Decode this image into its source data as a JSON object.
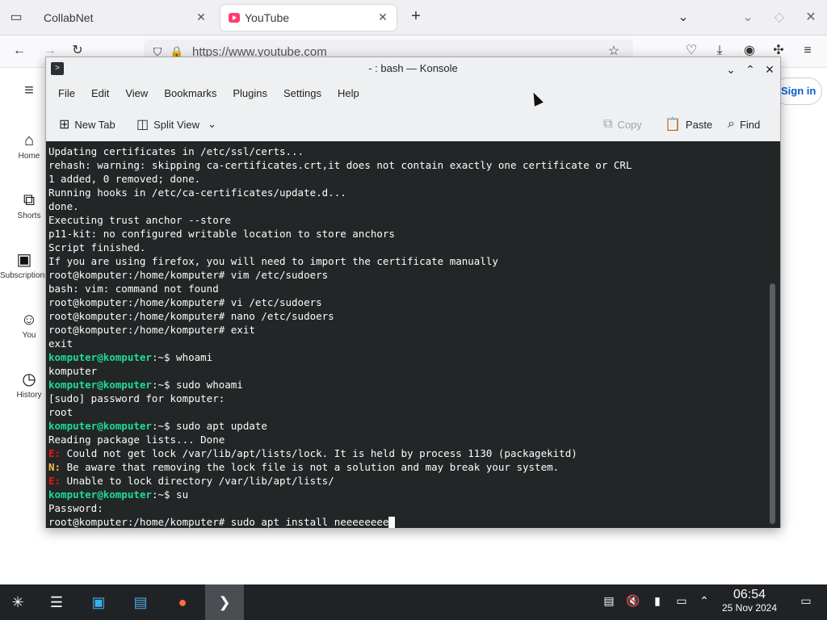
{
  "browser": {
    "tabs": [
      {
        "label": "CollabNet"
      },
      {
        "label": "YouTube"
      }
    ],
    "new_tab_glyph": "+",
    "url": "https://www.youtube.com"
  },
  "youtube": {
    "sidebar": [
      {
        "label": "Home",
        "icon": "home-icon"
      },
      {
        "label": "Shorts",
        "icon": "shorts-icon"
      },
      {
        "label": "Subscriptions",
        "icon": "subscriptions-icon"
      },
      {
        "label": "You",
        "icon": "you-icon"
      },
      {
        "label": "History",
        "icon": "history-icon"
      }
    ],
    "sign_in": "Sign in"
  },
  "konsole": {
    "title": "- : bash — Konsole",
    "menu": [
      "File",
      "Edit",
      "View",
      "Bookmarks",
      "Plugins",
      "Settings",
      "Help"
    ],
    "toolbar": {
      "new_tab": "New Tab",
      "split_view": "Split View",
      "copy": "Copy",
      "paste": "Paste",
      "find": "Find"
    },
    "lines": [
      {
        "type": "plain",
        "text": "Updating certificates in /etc/ssl/certs..."
      },
      {
        "type": "plain",
        "text": "rehash: warning: skipping ca-certificates.crt,it does not contain exactly one certificate or CRL"
      },
      {
        "type": "plain",
        "text": "1 added, 0 removed; done."
      },
      {
        "type": "plain",
        "text": "Running hooks in /etc/ca-certificates/update.d..."
      },
      {
        "type": "plain",
        "text": "done."
      },
      {
        "type": "plain",
        "text": "Executing trust anchor --store"
      },
      {
        "type": "plain",
        "text": "p11-kit: no configured writable location to store anchors"
      },
      {
        "type": "plain",
        "text": "Script finished."
      },
      {
        "type": "plain",
        "text": "If you are using firefox, you will need to import the certificate manually"
      },
      {
        "type": "plain",
        "text": "root@komputer:/home/komputer# vim /etc/sudoers"
      },
      {
        "type": "plain",
        "text": "bash: vim: command not found"
      },
      {
        "type": "plain",
        "text": "root@komputer:/home/komputer# vi /etc/sudoers"
      },
      {
        "type": "plain",
        "text": "root@komputer:/home/komputer# nano /etc/sudoers"
      },
      {
        "type": "plain",
        "text": "root@komputer:/home/komputer# exit"
      },
      {
        "type": "plain",
        "text": "exit"
      },
      {
        "type": "prompt",
        "user": "komputer@komputer",
        "path": ":~$ ",
        "cmd": "whoami"
      },
      {
        "type": "plain",
        "text": "komputer"
      },
      {
        "type": "prompt",
        "user": "komputer@komputer",
        "path": ":~$ ",
        "cmd": "sudo whoami"
      },
      {
        "type": "plain",
        "text": "[sudo] password for komputer:"
      },
      {
        "type": "plain",
        "text": "root"
      },
      {
        "type": "prompt",
        "user": "komputer@komputer",
        "path": ":~$ ",
        "cmd": "sudo apt update"
      },
      {
        "type": "plain",
        "text": "Reading package lists... Done"
      },
      {
        "type": "err",
        "tag": "E:",
        "text": " Could not get lock /var/lib/apt/lists/lock. It is held by process 1130 (packagekitd)"
      },
      {
        "type": "warn",
        "tag": "N:",
        "text": " Be aware that removing the lock file is not a solution and may break your system."
      },
      {
        "type": "err",
        "tag": "E:",
        "text": " Unable to lock directory /var/lib/apt/lists/"
      },
      {
        "type": "prompt",
        "user": "komputer@komputer",
        "path": ":~$ ",
        "cmd": "su"
      },
      {
        "type": "plain",
        "text": "Password:"
      },
      {
        "type": "current",
        "text": "root@komputer:/home/komputer# sudo apt install neeeeeeee"
      }
    ]
  },
  "taskbar": {
    "time": "06:54",
    "date": "25 Nov 2024"
  }
}
